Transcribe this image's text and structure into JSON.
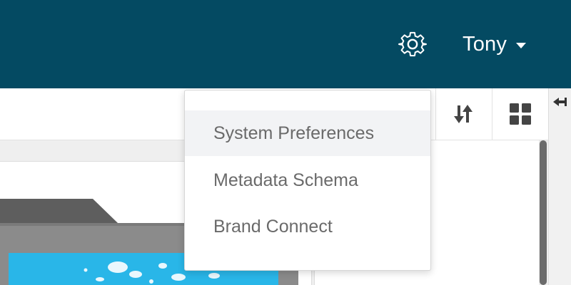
{
  "header": {
    "settings_icon": "gear-icon",
    "user": {
      "name": "Tony",
      "caret_icon": "caret-down-icon"
    },
    "background_color": "#044a62"
  },
  "toolbar": {
    "sort_icon": "sort-arrows-icon",
    "grid_view_icon": "grid-view-icon",
    "collapse_icon": "collapse-panel-icon"
  },
  "user_dropdown": {
    "items": [
      {
        "label": "System Preferences",
        "highlighted": true
      },
      {
        "label": "Metadata Schema",
        "highlighted": false
      },
      {
        "label": "Brand Connect",
        "highlighted": false
      }
    ]
  }
}
